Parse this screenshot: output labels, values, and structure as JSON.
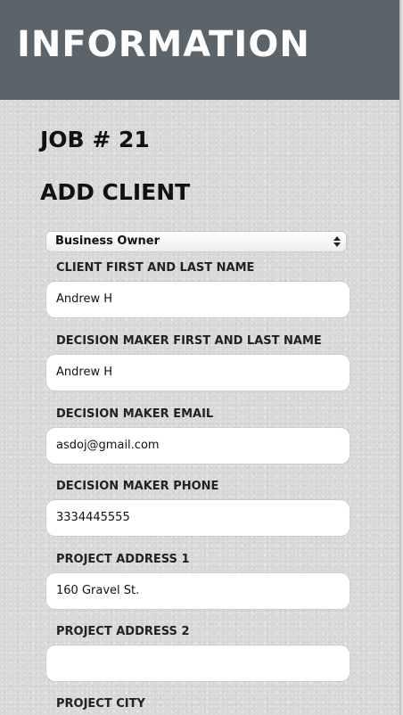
{
  "header": {
    "title": "INFORMATION"
  },
  "job": {
    "title": "JOB # 21"
  },
  "section": {
    "title": "ADD CLIENT"
  },
  "client_type": {
    "selected": "Business Owner"
  },
  "fields": [
    {
      "label": "CLIENT FIRST AND LAST NAME",
      "value": "Andrew H"
    },
    {
      "label": "DECISION MAKER FIRST AND LAST NAME",
      "value": "Andrew H"
    },
    {
      "label": "DECISION MAKER EMAIL",
      "value": "asdoj@gmail.com"
    },
    {
      "label": "DECISION MAKER PHONE",
      "value": "3334445555"
    },
    {
      "label": "PROJECT ADDRESS 1",
      "value": "160 Gravel St."
    },
    {
      "label": "PROJECT ADDRESS 2",
      "value": ""
    },
    {
      "label": "PROJECT CITY",
      "value": ""
    }
  ],
  "colors": {
    "header_bg": "#5b636b",
    "page_bg": "#d8d9d7",
    "input_bg": "#ffffff"
  }
}
